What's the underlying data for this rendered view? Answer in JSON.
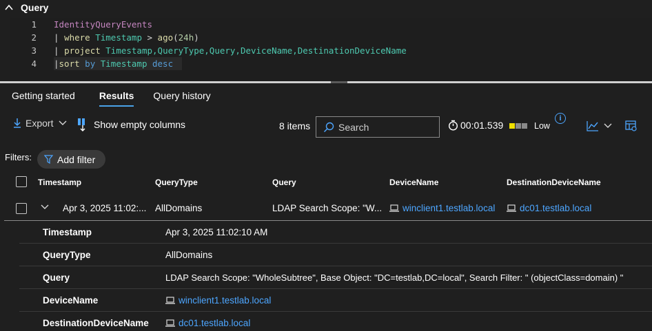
{
  "query_panel": {
    "title": "Query"
  },
  "editor": {
    "lines": [
      {
        "num": "1"
      },
      {
        "num": "2"
      },
      {
        "num": "3"
      },
      {
        "num": "4"
      }
    ],
    "tokens": {
      "l1_table": "IdentityQueryEvents",
      "l2_pipe": "| ",
      "l2_where": "where",
      "l2_col": "Timestamp",
      "l2_op": " > ",
      "l2_fn": "ago",
      "l2_open": "(",
      "l2_num": "24h",
      "l2_close": ")",
      "l3_pipe": "| ",
      "l3_project": "project",
      "l3_cols": "Timestamp,QueryType,Query,DeviceName,DestinationDeviceName",
      "l4_pipe": "|",
      "l4_sort": "sort",
      "l4_by": " by ",
      "l4_col": "Timestamp",
      "l4_desc": " desc"
    }
  },
  "tabs": [
    {
      "label": "Getting started"
    },
    {
      "label": "Results"
    },
    {
      "label": "Query history"
    }
  ],
  "toolbar": {
    "export_label": "Export",
    "show_empty_columns_label": "Show empty columns",
    "item_count": "8 items",
    "search_placeholder": "Search",
    "duration": "00:01.539",
    "resource_usage": "Low",
    "info_glyph": "i"
  },
  "filters": {
    "label": "Filters:",
    "add_filter_label": "Add filter"
  },
  "table": {
    "columns": [
      "Timestamp",
      "QueryType",
      "Query",
      "DeviceName",
      "DestinationDeviceName"
    ],
    "row": {
      "timestamp": "Apr 3, 2025 11:02:...",
      "query_type": "AllDomains",
      "query": "LDAP Search Scope: \"W...",
      "device_name": "winclient1.testlab.local",
      "destination_device_name": "dc01.testlab.local"
    }
  },
  "details": [
    {
      "key": "Timestamp",
      "value": "Apr 3, 2025 11:02:10 AM"
    },
    {
      "key": "QueryType",
      "value": "AllDomains"
    },
    {
      "key": "Query",
      "value": "LDAP Search Scope: \"WholeSubtree\", Base Object: \"DC=testlab,DC=local\", Search Filter: \" (objectClass=domain) \""
    },
    {
      "key": "DeviceName",
      "value": "winclient1.testlab.local"
    },
    {
      "key": "DestinationDeviceName",
      "value": "dc01.testlab.local"
    }
  ],
  "colors": {
    "background": "#1f1f1f",
    "accent": "#4aa3e8",
    "link": "#4da6ff",
    "usage_low": "#f0e000"
  }
}
